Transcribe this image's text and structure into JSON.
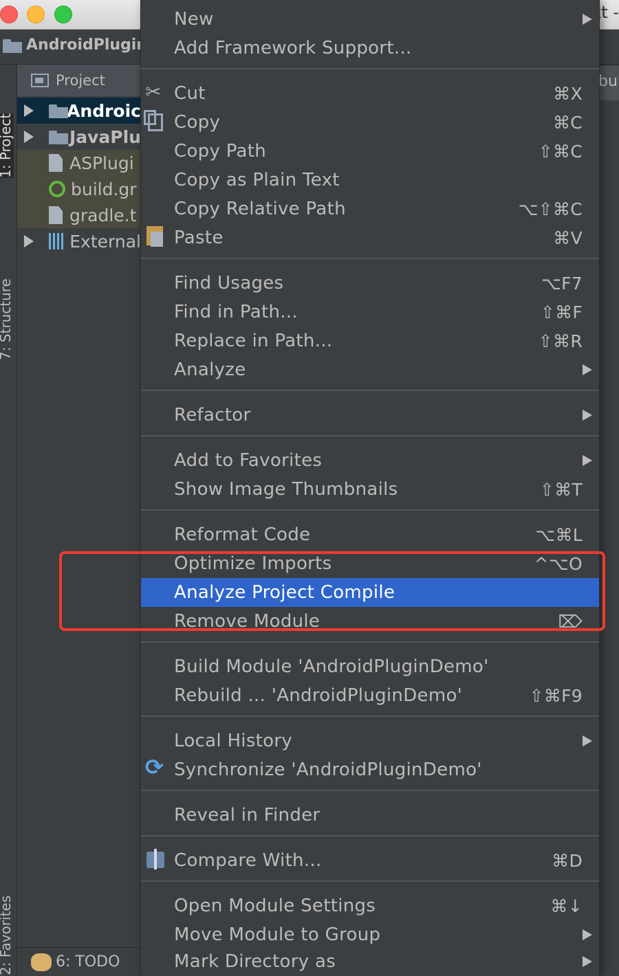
{
  "window": {
    "title_fragment": "kt -",
    "project_name": "AndroidPlugin"
  },
  "left_strip": {
    "tab_project": "1: Project",
    "tab_structure": "7: Structure",
    "tab_favorites": "2: Favorites"
  },
  "project_panel": {
    "header": "Project",
    "tree": [
      {
        "label": "Androic",
        "expandable": true,
        "selected": true,
        "icon": "folder-icon"
      },
      {
        "label": "JavaPlu",
        "expandable": true,
        "selected": false,
        "icon": "folder-icon"
      },
      {
        "label": "ASPlugi",
        "expandable": false,
        "selected": false,
        "icon": "file-icon"
      },
      {
        "label": "build.gr",
        "expandable": false,
        "selected": false,
        "icon": "gradle-icon"
      },
      {
        "label": "gradle.t",
        "expandable": false,
        "selected": false,
        "icon": "file-icon"
      },
      {
        "label": "External",
        "expandable": true,
        "selected": false,
        "icon": "library-icon"
      }
    ]
  },
  "bottom_bar": {
    "todo": "6: TODO"
  },
  "editor_tab_peek": "bui",
  "context_menu": {
    "groups": [
      [
        {
          "label": "New",
          "shortcut": "",
          "submenu": true
        },
        {
          "label": "Add Framework Support...",
          "shortcut": "",
          "submenu": false
        }
      ],
      [
        {
          "label": "Cut",
          "shortcut": "⌘X",
          "icon": "scissors-icon"
        },
        {
          "label": "Copy",
          "shortcut": "⌘C",
          "icon": "copy-icon"
        },
        {
          "label": "Copy Path",
          "shortcut": "⇧⌘C"
        },
        {
          "label": "Copy as Plain Text",
          "shortcut": ""
        },
        {
          "label": "Copy Relative Path",
          "shortcut": "⌥⇧⌘C"
        },
        {
          "label": "Paste",
          "shortcut": "⌘V",
          "icon": "paste-icon"
        }
      ],
      [
        {
          "label": "Find Usages",
          "shortcut": "⌥F7"
        },
        {
          "label": "Find in Path...",
          "shortcut": "⇧⌘F"
        },
        {
          "label": "Replace in Path...",
          "shortcut": "⇧⌘R"
        },
        {
          "label": "Analyze",
          "shortcut": "",
          "submenu": true
        }
      ],
      [
        {
          "label": "Refactor",
          "shortcut": "",
          "submenu": true
        }
      ],
      [
        {
          "label": "Add to Favorites",
          "shortcut": "",
          "submenu": true
        },
        {
          "label": "Show Image Thumbnails",
          "shortcut": "⇧⌘T"
        }
      ],
      [
        {
          "label": "Reformat Code",
          "shortcut": "⌥⌘L"
        },
        {
          "label": "Optimize Imports",
          "shortcut": "^⌥O"
        },
        {
          "label": "Analyze Project Compile",
          "shortcut": "",
          "highlighted": true
        },
        {
          "label": "Remove Module",
          "shortcut": "⌦"
        }
      ],
      [
        {
          "label": "Build Module 'AndroidPluginDemo'",
          "shortcut": ""
        },
        {
          "label": "Rebuild ... 'AndroidPluginDemo'",
          "shortcut": "⇧⌘F9"
        }
      ],
      [
        {
          "label": "Local History",
          "shortcut": "",
          "submenu": true
        },
        {
          "label": "Synchronize 'AndroidPluginDemo'",
          "shortcut": "",
          "icon": "sync-icon"
        }
      ],
      [
        {
          "label": "Reveal in Finder",
          "shortcut": ""
        }
      ],
      [
        {
          "label": "Compare With...",
          "shortcut": "⌘D",
          "icon": "compare-icon"
        }
      ],
      [
        {
          "label": "Open Module Settings",
          "shortcut": "⌘↓"
        },
        {
          "label": "Move Module to Group",
          "shortcut": "",
          "submenu": true
        },
        {
          "label": "Mark Directory as",
          "shortcut": "",
          "submenu": true
        }
      ]
    ]
  },
  "colors": {
    "highlight": "#2f65ca",
    "annotation_box": "#ee3b2f",
    "menu_bg": "#3c3f41"
  }
}
